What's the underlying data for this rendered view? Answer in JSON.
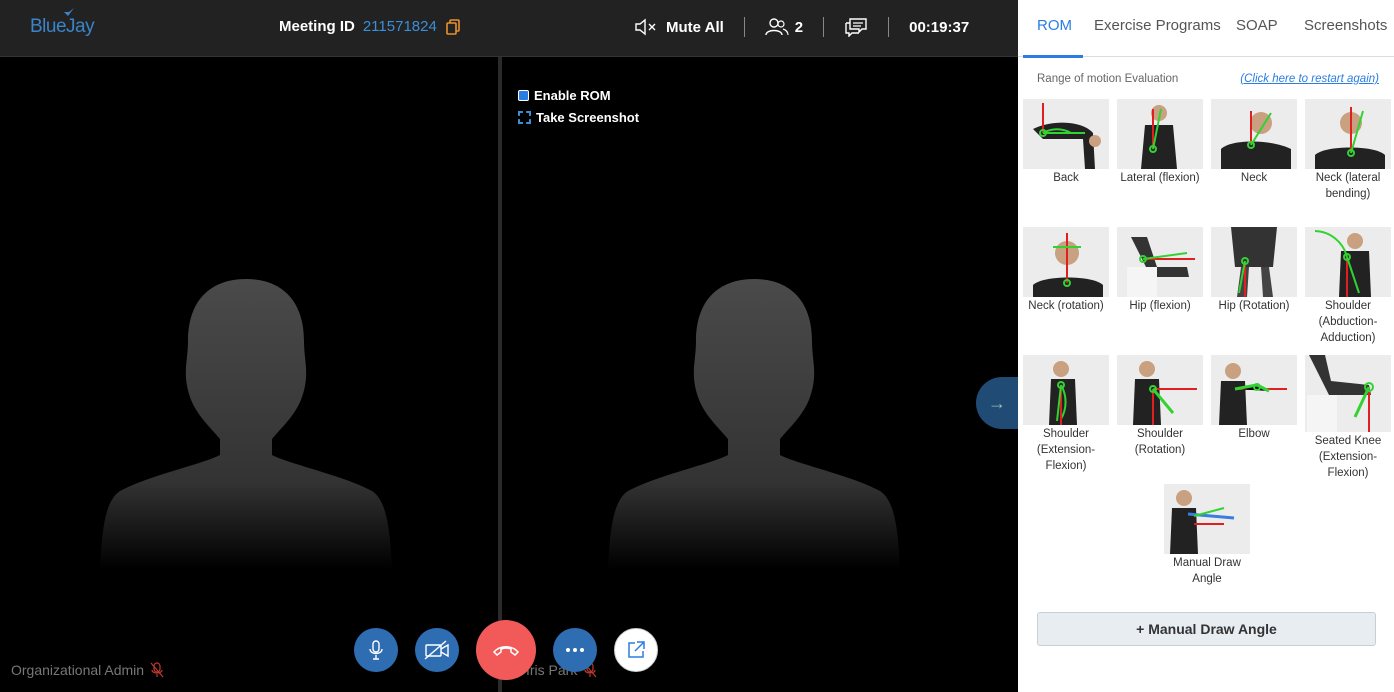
{
  "app": {
    "logo": "BlueJay"
  },
  "header": {
    "meeting_label": "Meeting ID",
    "meeting_id": "211571824",
    "mute_all": "Mute All",
    "participants": "2",
    "timer": "00:19:37"
  },
  "tiles": {
    "left_name": "Organizational Admin",
    "right_name": "Iris Park"
  },
  "rom_options": {
    "enable_rom": "Enable ROM",
    "take_screenshot": "Take Screenshot"
  },
  "panel": {
    "tabs": [
      {
        "label": "ROM"
      },
      {
        "label": "Exercise Programs"
      },
      {
        "label": "SOAP"
      },
      {
        "label": "Screenshots"
      }
    ],
    "rom_title": "Range of motion Evaluation",
    "restart": "(Click here to restart again)",
    "items": [
      {
        "label": "Back"
      },
      {
        "label": "Lateral (flexion)"
      },
      {
        "label": "Neck"
      },
      {
        "label": "Neck (lateral bending)"
      },
      {
        "label": "Neck (rotation)"
      },
      {
        "label": "Hip (flexion)"
      },
      {
        "label": "Hip (Rotation)"
      },
      {
        "label": "Shoulder (Abduction-Adduction)"
      },
      {
        "label": "Shoulder (Extension-Flexion)"
      },
      {
        "label": "Shoulder (Rotation)"
      },
      {
        "label": "Elbow"
      },
      {
        "label": "Seated Knee (Extension-Flexion)"
      },
      {
        "label": "Manual Draw Angle"
      }
    ],
    "manual_button": "+ Manual Draw Angle"
  },
  "colors": {
    "accent": "#2a7de1",
    "end_call": "#f25a5a",
    "control": "#2f6db3"
  }
}
